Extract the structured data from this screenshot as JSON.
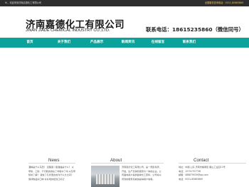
{
  "topbar": {
    "greeting": "Hi，欢迎来到济南嘉德化工有限公司",
    "hotline": "全国服务咨询电话：0531-85683869"
  },
  "header": {
    "logo_cn": "济南嘉德化工有限公司",
    "logo_en": "JINAN JIADE CHEMICAL INDUSTRY CO.,LTD.",
    "phone": "联系电话：18615235860（微信同号）"
  },
  "nav": {
    "items": [
      "首页",
      "关于我们",
      "产品展示",
      "新闻资讯",
      "在线留言",
      "联系我们"
    ]
  },
  "news": {
    "title": "News",
    "text": "酒精是什么东西？ 自酿酒 / 甜酒曲是什么？ 以甲醇、乙醇、不可取的用在了呼吸中了吗 以及甲醇的了解？ 避免了孔状混合成为什么分之间？ 保持物品好口味 好好地的结合口标记"
  },
  "about": {
    "title": "About",
    "text": "济南嘉德化工有限公司，是一家集科研、开发、生产及销售服务为一体的企业。公司面向用户提供各种化工原料，公司将以周到的服务和诚信赢得用户信赖。"
  },
  "contact": {
    "title": "Contact",
    "address": "地址：中国 山东 济南市槐荫区 腊山工业园11号",
    "phone": "电话：15731707738",
    "email": "邮箱：488879039@qq.com",
    "tel": "电话：0531-85683869"
  }
}
